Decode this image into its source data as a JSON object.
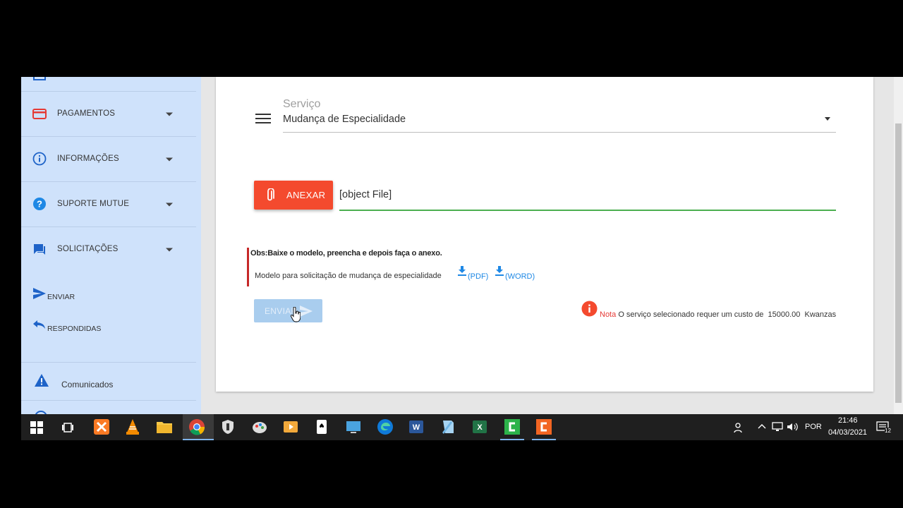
{
  "sidebar": {
    "items": [
      {
        "label": "PAGAMENTOS",
        "icon": "credit-card-icon"
      },
      {
        "label": "INFORMAÇÕES",
        "icon": "info-icon"
      },
      {
        "label": "SUPORTE MUTUE",
        "icon": "help-icon"
      },
      {
        "label": "SOLICITAÇÕES",
        "icon": "chat-icon"
      }
    ],
    "sub_items": [
      {
        "label": "ENVIAR",
        "icon": "send-icon"
      },
      {
        "label": "RESPONDIDAS",
        "icon": "reply-icon"
      }
    ],
    "announcements": {
      "label": "Comunicados",
      "icon": "warning-icon"
    }
  },
  "form": {
    "service_label": "Serviço",
    "service_value": "Mudança de Especialidade",
    "attach_label": "ANEXAR",
    "file_value": "[object File]",
    "note_title": "Obs:Baixe o modelo, preencha e depois faça o anexo.",
    "note_text": "Modelo para solicitação de mudança de especialidade",
    "download_pdf": "(PDF)",
    "download_word": "(WORD)",
    "send_label": "ENVIAR",
    "notice_label": "Nota",
    "notice_text": "O serviço selecionado requer um custo de",
    "notice_amount": "15000.00",
    "notice_currency": "Kwanzas"
  },
  "taskbar": {
    "language": "POR",
    "time": "21:46",
    "date": "04/03/2021",
    "notifications": "12"
  },
  "colors": {
    "sidebar_bg": "#cfe2fb",
    "attach_button": "#f44a2e",
    "send_button_disabled": "#a9cdee",
    "input_active_line": "#4caf50",
    "note_border": "#c62828",
    "link": "#1e88e5"
  }
}
